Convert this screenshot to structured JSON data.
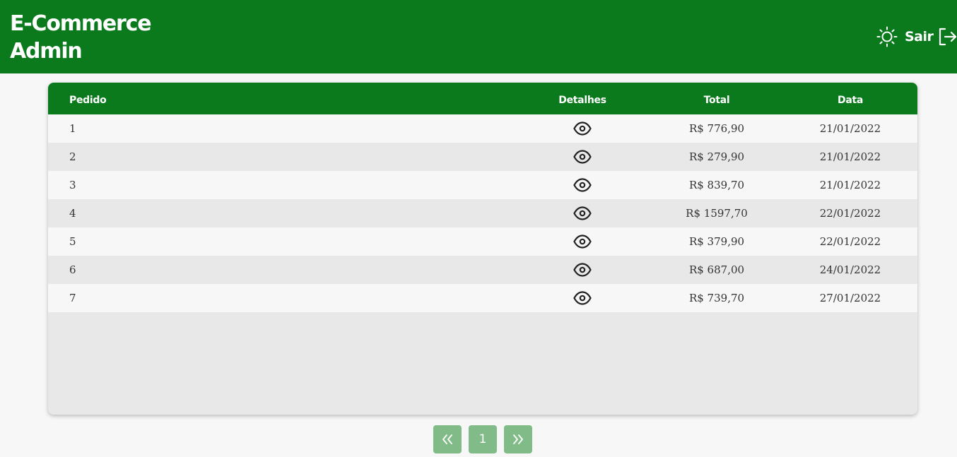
{
  "header": {
    "brand_line1": "E-Commerce",
    "brand_line2": "Admin",
    "theme_icon": "sun-icon",
    "logout_label": "Sair",
    "logout_icon": "logout-icon"
  },
  "table": {
    "columns": [
      "Pedido",
      "Detalhes",
      "Total",
      "Data"
    ],
    "rows": [
      {
        "id": "1",
        "total": "R$ 776,90",
        "date": "21/01/2022"
      },
      {
        "id": "2",
        "total": "R$ 279,90",
        "date": "21/01/2022"
      },
      {
        "id": "3",
        "total": "R$ 839,70",
        "date": "21/01/2022"
      },
      {
        "id": "4",
        "total": "R$ 1597,70",
        "date": "22/01/2022"
      },
      {
        "id": "5",
        "total": "R$ 379,90",
        "date": "22/01/2022"
      },
      {
        "id": "6",
        "total": "R$ 687,00",
        "date": "24/01/2022"
      },
      {
        "id": "7",
        "total": "R$ 739,70",
        "date": "27/01/2022"
      }
    ],
    "details_icon": "eye-icon"
  },
  "pagination": {
    "first_icon": "double-chevron-left-icon",
    "current_page": "1",
    "last_icon": "double-chevron-right-icon"
  },
  "colors": {
    "primary": "#0a7a1c",
    "pager_button": "#80bb88",
    "row_light": "#f7f7f7",
    "row_dark": "#e8e8e8"
  }
}
